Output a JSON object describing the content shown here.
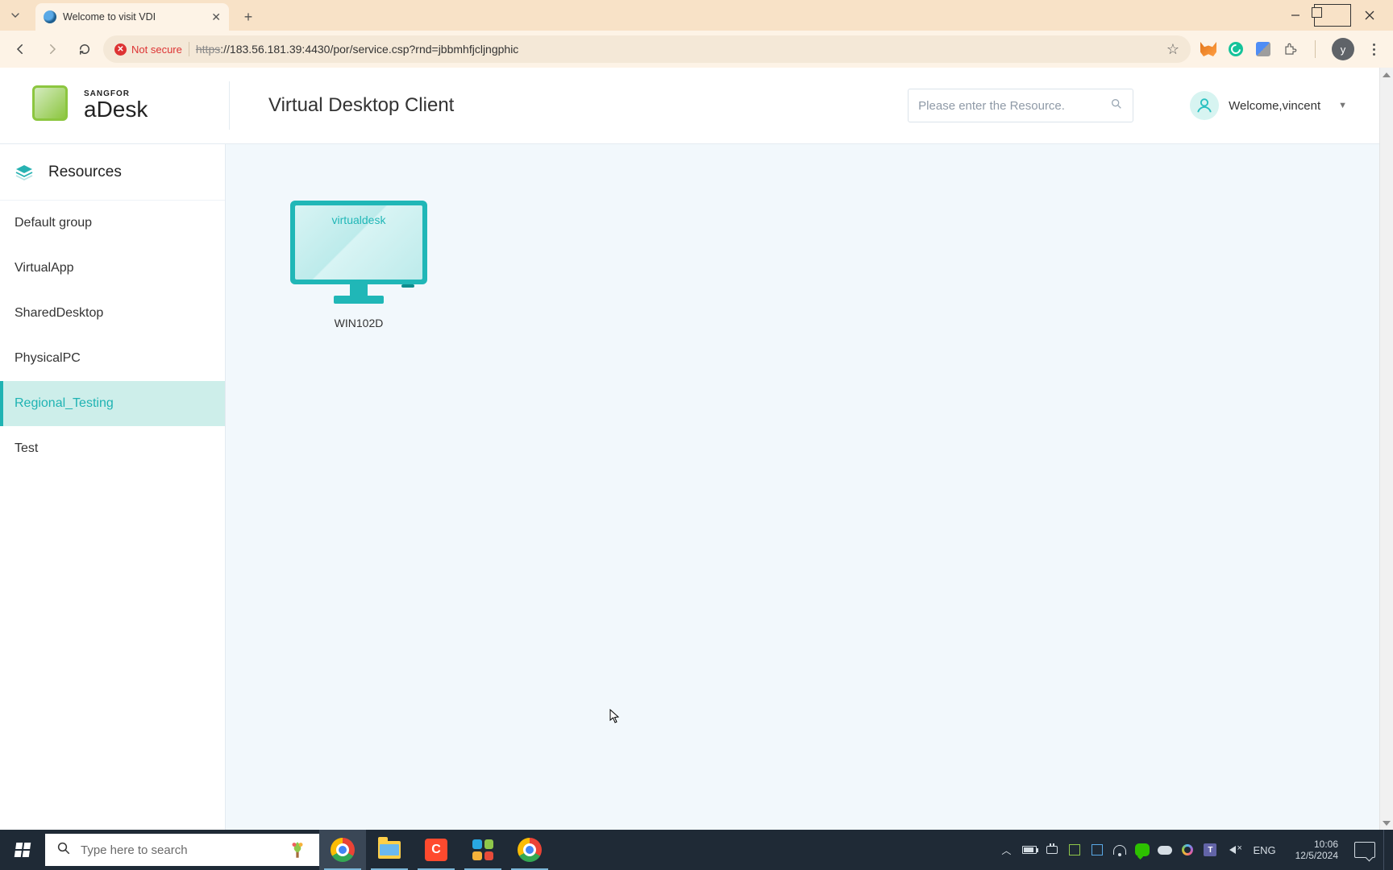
{
  "browser": {
    "tab_title": "Welcome to visit VDI",
    "not_secure": "Not secure",
    "url_proto": "https",
    "url_rest": "://183.56.181.39:4430/por/service.csp?rnd=jbbmhfjcljngphic",
    "avatar_letter": "y"
  },
  "brand": {
    "top": "SANGFOR",
    "main": "aDesk"
  },
  "page_title": "Virtual Desktop Client",
  "search_placeholder": "Please enter the Resource.",
  "welcome": "Welcome,vincent",
  "sidebar": {
    "header": "Resources",
    "items": [
      {
        "label": "Default group"
      },
      {
        "label": "VirtualApp"
      },
      {
        "label": "SharedDesktop"
      },
      {
        "label": "PhysicalPC"
      },
      {
        "label": "Regional_Testing"
      },
      {
        "label": "Test"
      }
    ]
  },
  "resource": {
    "inner_label": "virtualdesk",
    "caption": "WIN102D"
  },
  "taskbar": {
    "search_placeholder": "Type here to search",
    "lang": "ENG",
    "time": "10:06",
    "date": "12/5/2024"
  }
}
